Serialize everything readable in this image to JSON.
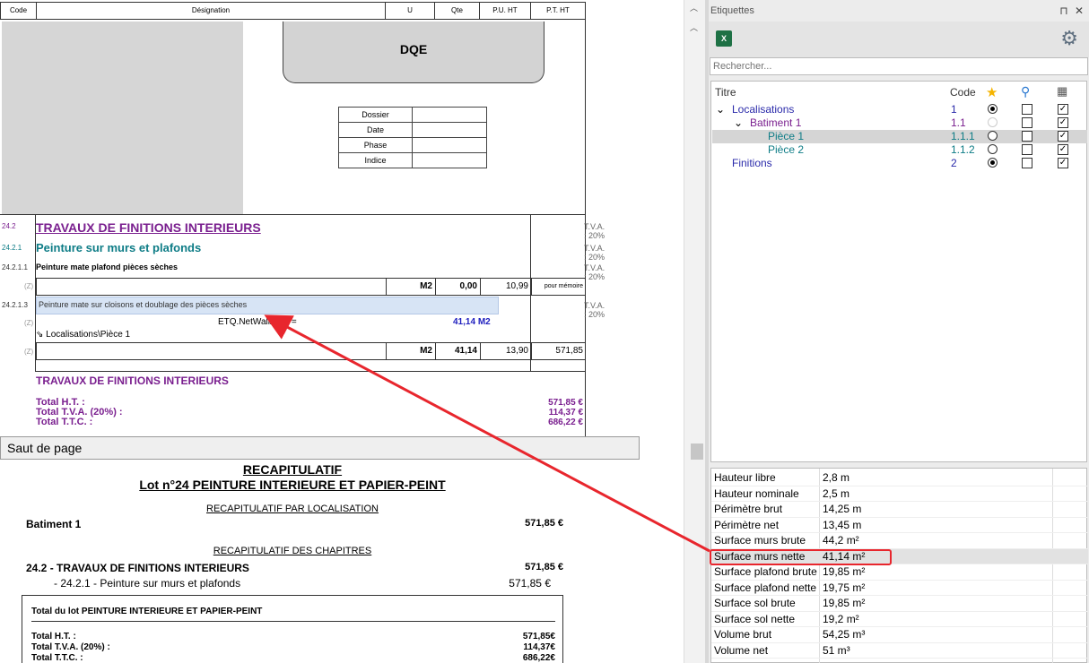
{
  "columns": {
    "code": "Code",
    "designation": "Désignation",
    "unit": "U",
    "qty": "Qte",
    "pu": "P.U. HT",
    "pt": "P.T. HT"
  },
  "dqe": {
    "title": "DQE",
    "fields": [
      "Dossier",
      "Date",
      "Phase",
      "Indice"
    ]
  },
  "sections": {
    "chap_code": "24.2",
    "chap_title": "TRAVAUX DE FINITIONS INTERIEURS",
    "sub_code": "24.2.1",
    "sub_title": "Peinture sur murs et plafonds",
    "art1_code": "24.2.1.1",
    "art1_title": "Peinture mate plafond pièces sèches",
    "art1_z": "(Z)",
    "art1_unit": "M2",
    "art1_qty": "0,00",
    "art1_pu": "10,99",
    "art1_pt": "pour mémoire",
    "art2_code": "24.2.1.3",
    "art2_title": "Peinture mate sur cloisons et doublage des pièces sèches",
    "art2_z1": "(Z)",
    "formula": "ETQ.NetWallArea =",
    "formula_value": "41,14",
    "formula_unit": "M2",
    "location": "Localisations\\Pièce 1",
    "art2_z2": "(Z)",
    "art2_unit": "M2",
    "art2_qty": "41,14",
    "art2_pu": "13,90",
    "art2_pt": "571,85",
    "tva": "T.V.A. : 20%",
    "footer_title": "TRAVAUX DE FINITIONS INTERIEURS",
    "total_ht_label": "Total H.T. :",
    "total_tva_label": "Total T.V.A. (20%) :",
    "total_ttc_label": "Total T.T.C. :",
    "total_ht": "571,85 €",
    "total_tva": "114,37 €",
    "total_ttc": "686,22 €"
  },
  "page_break": "Saut de page",
  "recap": {
    "title": "RECAPITULATIF",
    "lot": "Lot n°24 PEINTURE INTERIEURE ET PAPIER-PEINT",
    "by_loc_title": "RECAPITULATIF PAR LOCALISATION",
    "bat_label": "Batiment 1",
    "bat_value": "571,85 €",
    "chap_title": "RECAPITULATIF DES CHAPITRES",
    "chap_line": "24.2 - TRAVAUX DE FINITIONS INTERIEURS",
    "chap_value": "571,85 €",
    "sub_line": "- 24.2.1 - Peinture sur murs et plafonds",
    "sub_value": "571,85 €",
    "lot_total_title": "Total du lot PEINTURE INTERIEURE ET PAPIER-PEINT",
    "lot_ht_label": "Total H.T. :",
    "lot_tva_label": "Total T.V.A. (20%) :",
    "lot_ttc_label": "Total T.T.C. :",
    "lot_ht": "571,85€",
    "lot_tva": "114,37€",
    "lot_ttc": "686,22€"
  },
  "panel": {
    "title": "Etiquettes",
    "pin": "⊓",
    "close": "✕",
    "search_placeholder": "Rechercher...",
    "head_title": "Titre",
    "head_code": "Code",
    "tree": [
      {
        "label": "Localisations",
        "code": "1",
        "expander": "⌄"
      },
      {
        "label": "Batiment 1",
        "code": "1.1",
        "expander": "⌄"
      },
      {
        "label": "Pièce 1",
        "code": "1.1.1"
      },
      {
        "label": "Pièce 2",
        "code": "1.1.2"
      },
      {
        "label": "Finitions",
        "code": "2"
      }
    ],
    "properties": [
      {
        "name": "Hauteur libre",
        "value": "2,8 m"
      },
      {
        "name": "Hauteur nominale",
        "value": "2,5 m"
      },
      {
        "name": "Périmètre brut",
        "value": "14,25 m"
      },
      {
        "name": "Périmètre net",
        "value": "13,45 m"
      },
      {
        "name": "Surface murs brute",
        "value": "44,2 m²"
      },
      {
        "name": "Surface murs nette",
        "value": "41,14 m²"
      },
      {
        "name": "Surface plafond brute",
        "value": "19,85 m²"
      },
      {
        "name": "Surface plafond nette",
        "value": "19,75 m²"
      },
      {
        "name": "Surface sol brute",
        "value": "19,85 m²"
      },
      {
        "name": "Surface sol nette",
        "value": "19,2 m²"
      },
      {
        "name": "Volume brut",
        "value": "54,25 m³"
      },
      {
        "name": "Volume net",
        "value": "51 m³"
      }
    ]
  },
  "colors": {
    "accent_red": "#e8262d",
    "purple": "#7a1f8f",
    "teal": "#0d7c86",
    "blue": "#2a2aaa"
  }
}
